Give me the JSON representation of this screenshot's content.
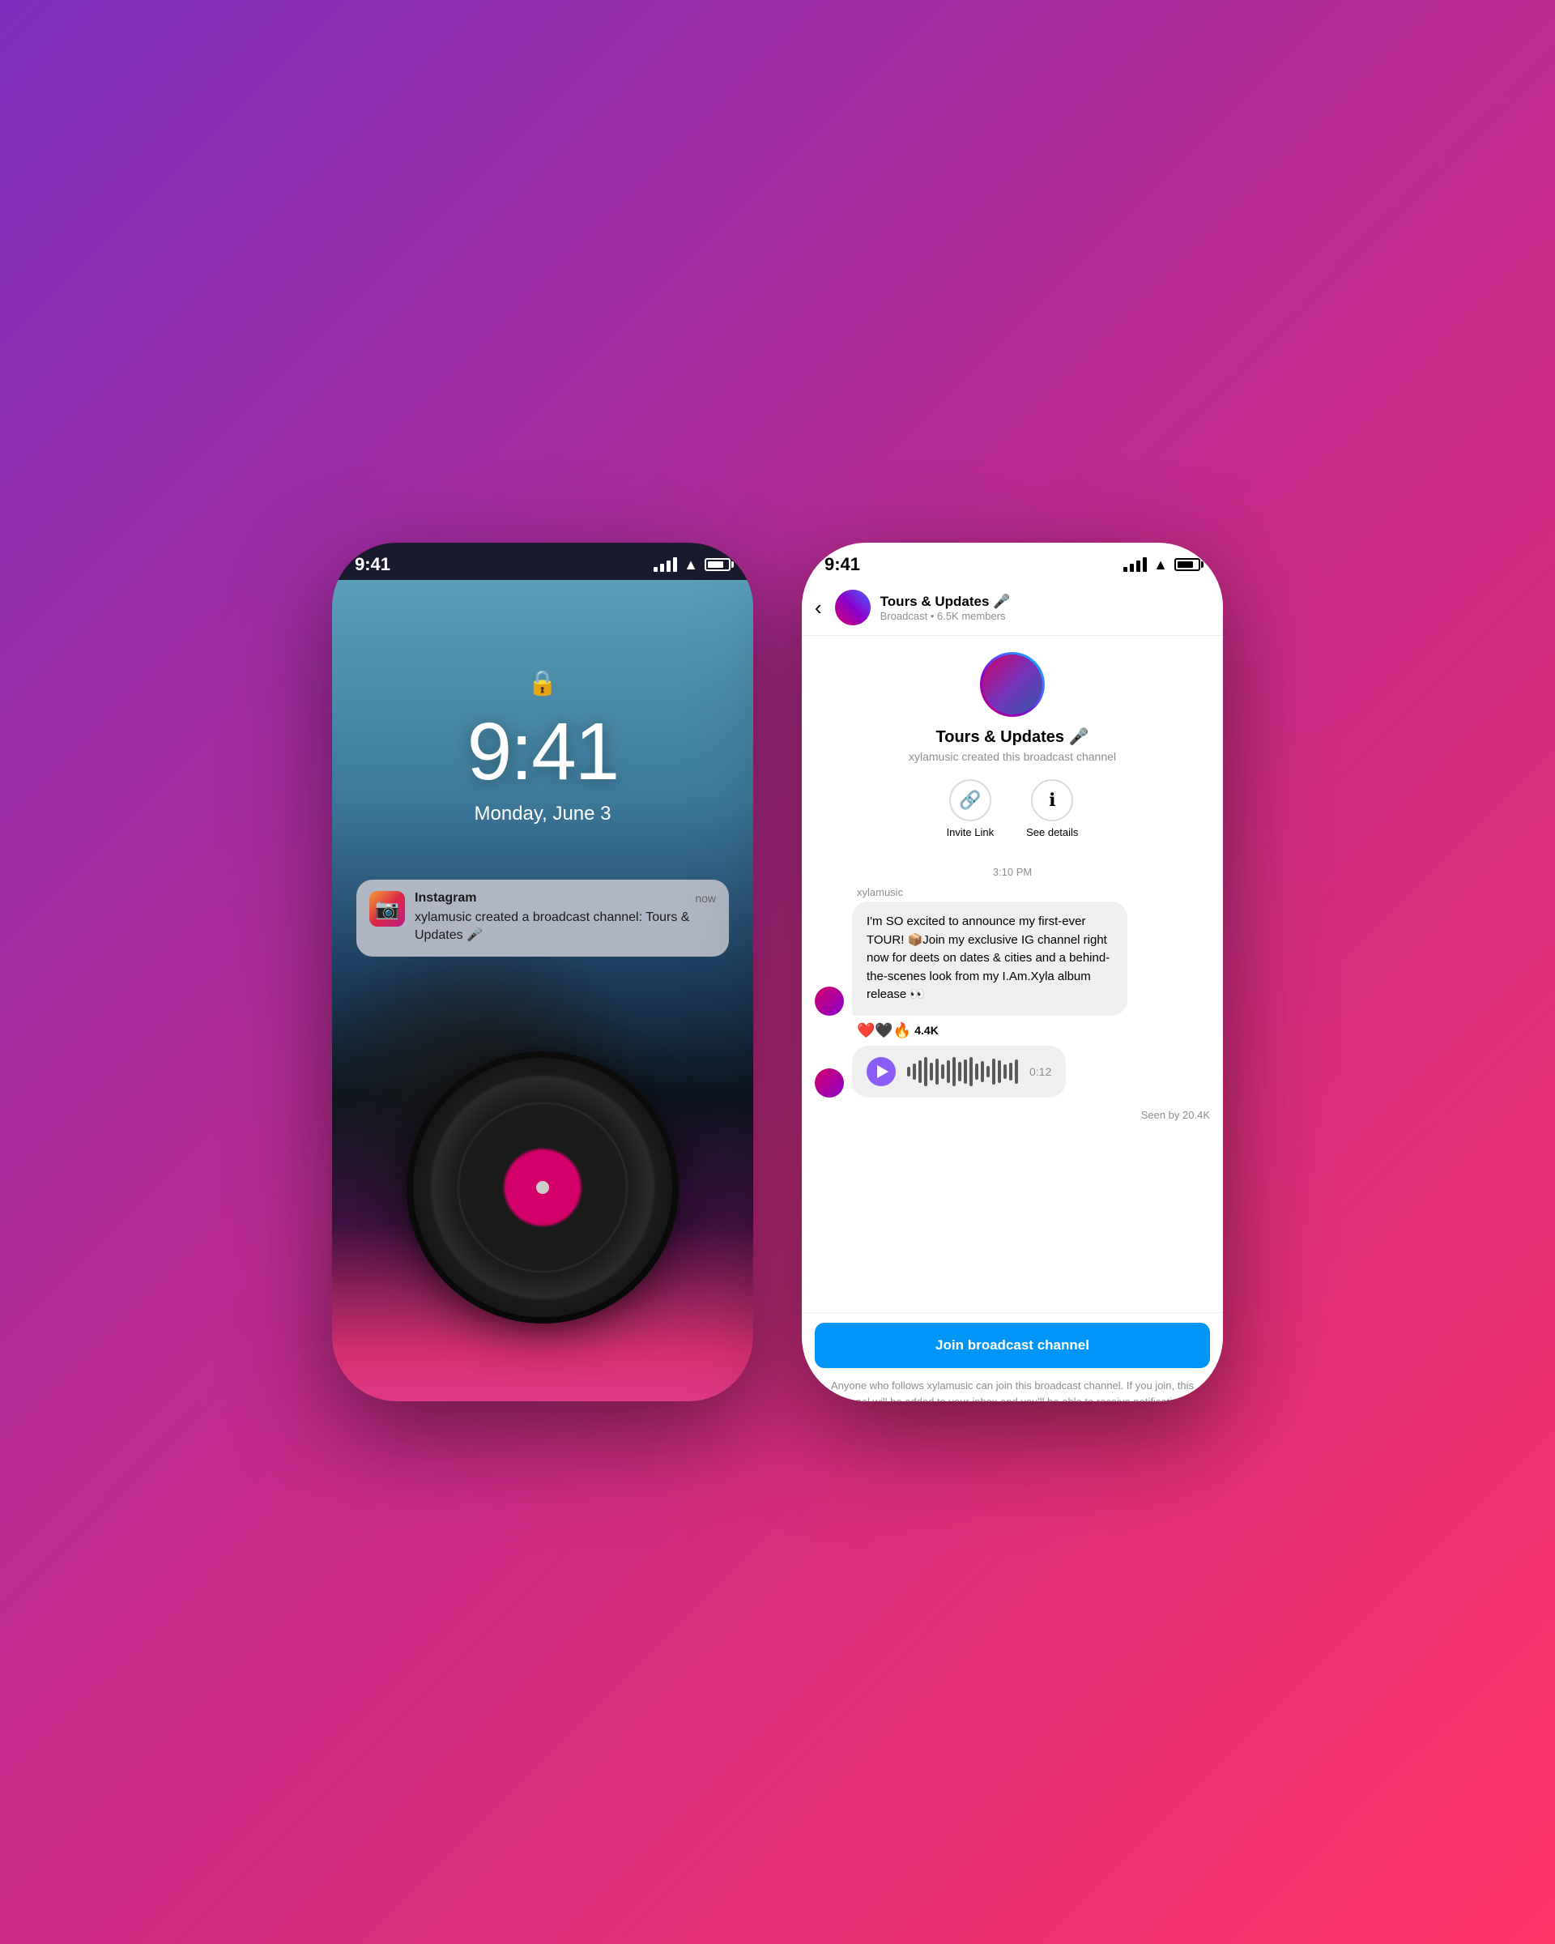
{
  "background": {
    "gradient_start": "#7B2FBE",
    "gradient_mid": "#C42B8A",
    "gradient_end": "#FF3366"
  },
  "left_phone": {
    "status_bar": {
      "time": "9:41",
      "signal": "4-bars",
      "wifi": "wifi",
      "battery": "battery"
    },
    "lock_time": "9:41",
    "lock_date": "Monday, June 3",
    "notification": {
      "app": "Instagram",
      "time": "now",
      "text": "xylamusic created a broadcast channel: Tours & Updates 🎤"
    }
  },
  "right_phone": {
    "status_bar": {
      "time": "9:41",
      "signal": "4-bars",
      "wifi": "wifi",
      "battery": "battery"
    },
    "header": {
      "back_label": "‹",
      "channel_name": "Tours & Updates 🎤",
      "channel_sub": "Broadcast • 6.5K members"
    },
    "profile": {
      "name": "Tours & Updates 🎤",
      "created_by": "xylamusic created this broadcast channel",
      "invite_label": "Invite Link",
      "details_label": "See details"
    },
    "messages": {
      "time_separator": "3:10 PM",
      "sender": "xylamusic",
      "message_text": "I'm SO excited to announce my first-ever TOUR! 📦Join my exclusive IG channel right now for deets on dates & cities and a behind-the-scenes look from my I.Am.Xyla album release 👀",
      "reactions": "❤️🖤🔥",
      "reaction_count": "4.4K",
      "audio_duration": "0:12",
      "seen_by": "Seen by 20.4K"
    },
    "join_area": {
      "button_label": "Join broadcast channel",
      "disclaimer": "Anyone who follows xylamusic can join this broadcast channel. If you join, this channel will be added to your inbox and you'll be able to receive notifications."
    }
  }
}
